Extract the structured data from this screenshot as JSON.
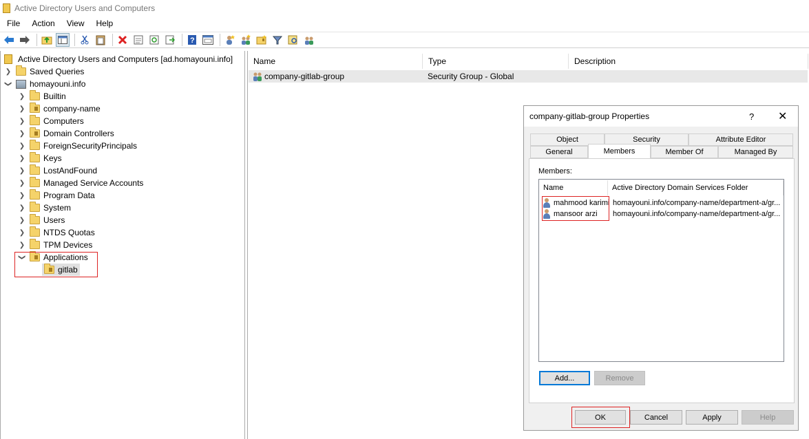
{
  "window": {
    "title": "Active Directory Users and Computers"
  },
  "menu": [
    "File",
    "Action",
    "View",
    "Help"
  ],
  "toolbar_icons": [
    "back-arrow-icon",
    "forward-arrow-icon",
    "up-folder-icon",
    "show-console-tree-icon",
    "cut-icon",
    "paste-icon",
    "delete-icon",
    "properties-icon",
    "refresh-icon",
    "export-list-icon",
    "help-icon",
    "console-icon",
    "new-user-icon",
    "new-group-icon",
    "new-ou-icon",
    "filter-icon",
    "find-icon",
    "add-to-group-icon"
  ],
  "tree": {
    "root": "Active Directory Users and Computers [ad.homayouni.info]",
    "saved_queries": "Saved Queries",
    "domain": "homayouni.info",
    "children": [
      "Builtin",
      "company-name",
      "Computers",
      "Domain Controllers",
      "ForeignSecurityPrincipals",
      "Keys",
      "LostAndFound",
      "Managed Service Accounts",
      "Program Data",
      "System",
      "Users",
      "NTDS Quotas",
      "TPM Devices",
      "Applications"
    ],
    "applications_child": "gitlab"
  },
  "list": {
    "columns": [
      "Name",
      "Type",
      "Description"
    ],
    "rows": [
      {
        "name": "company-gitlab-group",
        "type": "Security Group - Global",
        "description": ""
      }
    ]
  },
  "dialog": {
    "title": "company-gitlab-group Properties",
    "help": "?",
    "close": "✕",
    "tabs_row1": [
      "Object",
      "Security",
      "Attribute Editor"
    ],
    "tabs_row2": [
      "General",
      "Members",
      "Member Of",
      "Managed By"
    ],
    "members_label": "Members:",
    "columns": [
      "Name",
      "Active Directory Domain Services Folder"
    ],
    "members": [
      {
        "name": "mahmood karimi",
        "folder": "homayouni.info/company-name/department-a/gr..."
      },
      {
        "name": "mansoor arzi",
        "folder": "homayouni.info/company-name/department-a/gr..."
      }
    ],
    "buttons": {
      "add": "Add...",
      "remove": "Remove",
      "ok": "OK",
      "cancel": "Cancel",
      "apply": "Apply",
      "help": "Help"
    }
  },
  "colors": {
    "highlight": "#d22222",
    "selection": "#e8e8e8",
    "focus": "#0078d7"
  }
}
